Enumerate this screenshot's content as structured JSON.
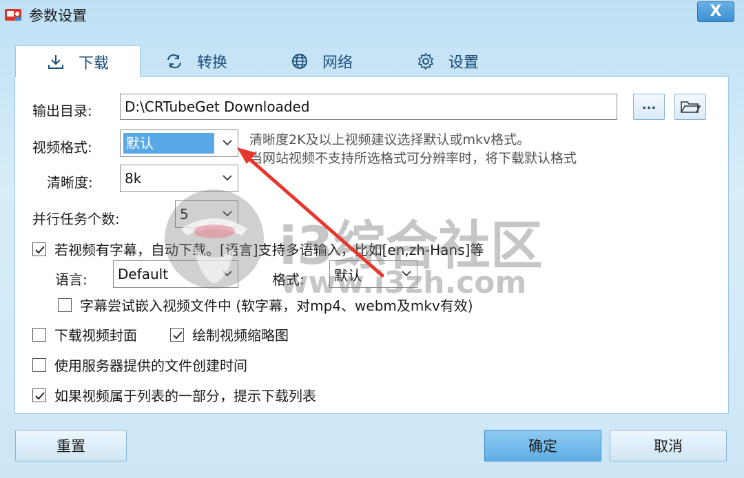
{
  "window": {
    "title": "参数设置",
    "close_label": "X"
  },
  "tabs": [
    {
      "label": "下载",
      "icon": "download-icon",
      "active": true
    },
    {
      "label": "转换",
      "icon": "convert-icon",
      "active": false
    },
    {
      "label": "网络",
      "icon": "globe-icon",
      "active": false
    },
    {
      "label": "设置",
      "icon": "gear-icon",
      "active": false
    }
  ],
  "form": {
    "output_dir_label": "输出目录:",
    "output_dir_value": "D:\\CRTubeGet Downloaded",
    "browse_label": "...",
    "video_format_label": "视频格式:",
    "video_format_value": "默认",
    "hint_line1": "清晰度2K及以上视频建议选择默认或mkv格式。",
    "hint_line2": "当网站视频不支持所选格式可分辨率时，将下载默认格式",
    "resolution_label": "清晰度:",
    "resolution_value": "8k",
    "parallel_label": "并行任务个数:",
    "parallel_value": "5",
    "subtitle_check_label": "若视频有字幕，自动下载。[语言]支持多语输入，比如[en,zh-Hans]等",
    "subtitle_checked": true,
    "language_label": "语言:",
    "language_value": "Default",
    "sub_format_label": "格式:",
    "sub_format_value": "默认",
    "embed_label": "字幕尝试嵌入视频文件中 (软字幕，对mp4、webm及mkv有效)",
    "embed_checked": false,
    "cover_label": "下载视频封面",
    "cover_checked": false,
    "thumb_label": "绘制视频缩略图",
    "thumb_checked": true,
    "server_time_label": "使用服务器提供的文件创建时间",
    "server_time_checked": false,
    "playlist_label": "如果视频属于列表的一部分，提示下载列表",
    "playlist_checked": true
  },
  "buttons": {
    "reset": "重置",
    "ok": "确定",
    "cancel": "取消"
  },
  "watermark": {
    "brand": "i3综合社区",
    "url": "www.i3zh.com"
  },
  "colors": {
    "accent": "#5aa9e6",
    "annotation_arrow": "#e8362c"
  }
}
